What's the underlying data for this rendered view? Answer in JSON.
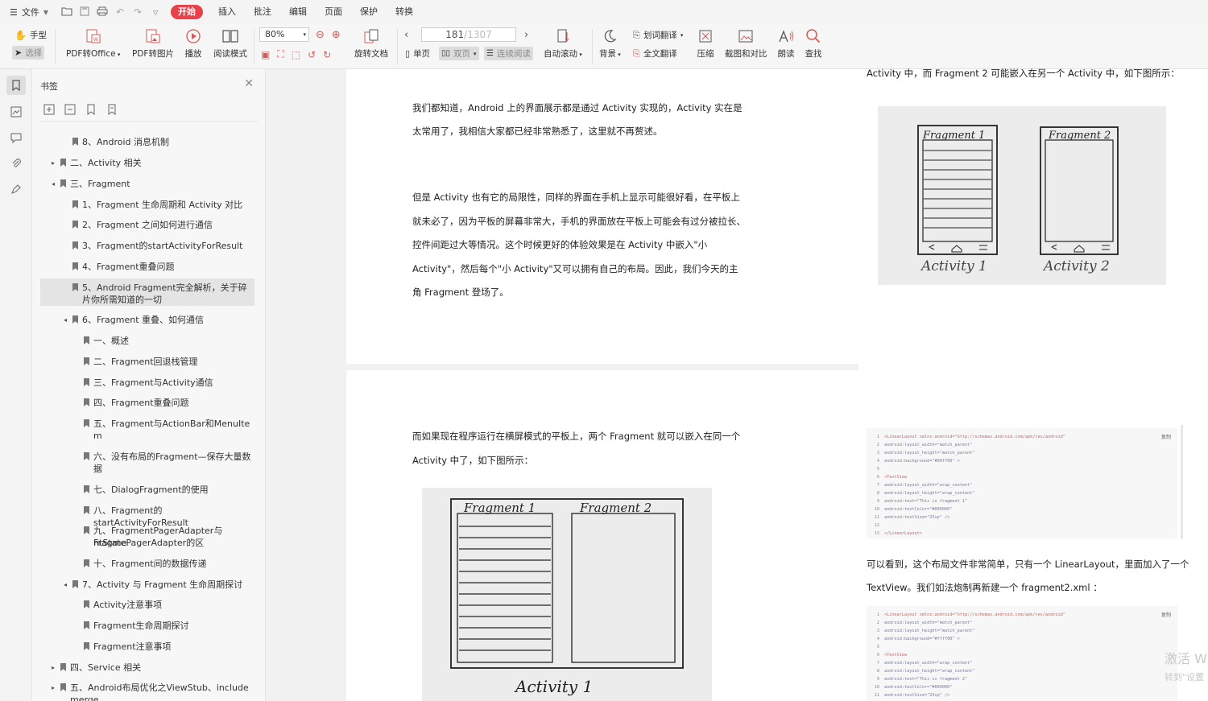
{
  "menubar": {
    "file": "文件",
    "tabs": [
      "开始",
      "插入",
      "批注",
      "编辑",
      "页面",
      "保护",
      "转换"
    ],
    "active_tab": "开始"
  },
  "toolbar": {
    "hand": "手型",
    "select": "选择",
    "pdf2office": "PDF转Office",
    "pdf2image": "PDF转图片",
    "play": "播放",
    "read_mode": "阅读模式",
    "zoom": "80%",
    "rotate": "旋转文档",
    "single": "单页",
    "double": "双页",
    "continuous": "连续阅读",
    "page_current": "181",
    "page_total": "/1307",
    "auto_scroll": "自动滚动",
    "background": "背景",
    "word_translate": "划词翻译",
    "full_translate": "全文翻译",
    "compress": "压缩",
    "screenshot_compare": "截图和对比",
    "read_aloud": "朗读",
    "find": "查找"
  },
  "bookmarks": {
    "title": "书签",
    "items": [
      {
        "text": "8、Android 消息机制",
        "level": 1,
        "arrow": ""
      },
      {
        "text": "二、Activity 相关",
        "level": 0,
        "arrow": "▸"
      },
      {
        "text": "三、Fragment",
        "level": 0,
        "arrow": "◂"
      },
      {
        "text": "1、Fragment 生命周期和 Activity 对比",
        "level": 1,
        "arrow": ""
      },
      {
        "text": "2、Fragment 之间如何进行通信",
        "level": 1,
        "arrow": ""
      },
      {
        "text": "3、Fragment的startActivityForResult",
        "level": 1,
        "arrow": ""
      },
      {
        "text": "4、Fragment重叠问题",
        "level": 1,
        "arrow": ""
      },
      {
        "text": "5、Android Fragment完全解析，关于碎",
        "text2": "片你所需知道的一切",
        "level": 1,
        "arrow": "",
        "selected": true
      },
      {
        "text": "6、Fragment 重叠、如何通信",
        "level": 1,
        "arrow": "◂"
      },
      {
        "text": "一、概述",
        "level": 2,
        "arrow": ""
      },
      {
        "text": "二、Fragment回退栈管理",
        "level": 2,
        "arrow": ""
      },
      {
        "text": "三、Fragment与Activity通信",
        "level": 2,
        "arrow": ""
      },
      {
        "text": "四、Fragment重叠问题",
        "level": 2,
        "arrow": ""
      },
      {
        "text": "五、Fragment与ActionBar和MenuIte",
        "text2": "m",
        "level": 2,
        "arrow": ""
      },
      {
        "text": "六、没有布局的Fragment—保存大量数",
        "text2": "据",
        "level": 2,
        "arrow": ""
      },
      {
        "text": "七、DialogFragment的使用",
        "level": 2,
        "arrow": ""
      },
      {
        "text": "八、Fragment的startActivityForResult",
        "level": 2,
        "arrow": ""
      },
      {
        "text": "九、FragmentPagerAdapter与Fragme",
        "text2": "ntStatePagerAdapter的区",
        "level": 2,
        "arrow": ""
      },
      {
        "text": "十、Fragment间的数据传递",
        "level": 2,
        "arrow": ""
      },
      {
        "text": "7、Activity 与 Fragment 生命周期探讨",
        "level": 1,
        "arrow": "◂"
      },
      {
        "text": "Activity注意事项",
        "level": 2,
        "arrow": ""
      },
      {
        "text": "Fragment生命周期探讨",
        "level": 2,
        "arrow": ""
      },
      {
        "text": "Fragment注意事项",
        "level": 2,
        "arrow": ""
      },
      {
        "text": "四、Service 相关",
        "level": 0,
        "arrow": "▸"
      },
      {
        "text": "五、Android布局优化之ViewStub、include",
        "text2": "merge",
        "level": 0,
        "arrow": "▸"
      }
    ]
  },
  "doc": {
    "left_page_1": [
      "我们都知道，Android 上的界面展示都是通过 Activity 实现的，Activity 实在是",
      "太常用了，我相信大家都已经非常熟悉了，这里就不再赘述。",
      "但是 Activity 也有它的局限性，同样的界面在手机上显示可能很好看，在平板上",
      "就未必了，因为平板的屏幕非常大，手机的界面放在平板上可能会有过分被拉长、",
      "控件间距过大等情况。这个时候更好的体验效果是在 Activity 中嵌入\"小",
      "Activity\"，然后每个\"小 Activity\"又可以拥有自己的布局。因此，我们今天的主",
      "角 Fragment 登场了。"
    ],
    "left_page_2": [
      "而如果现在程序运行在横屏模式的平板上，两个 Fragment 就可以嵌入在同一个",
      "Activity 中了，如下图所示："
    ],
    "right_top_line": "Activity 中，而 Fragment 2 可能嵌入在另一个 Activity 中，如下图所示：",
    "right_mid": [
      "可以看到，这个布局文件非常简单，只有一个 LinearLayout，里面加入了一个",
      "TextView。我们如法炮制再新建一个 fragment2.xml ："
    ],
    "sketch_labels": {
      "fragment1": "Fragment 1",
      "fragment2": "Fragment 2",
      "activity1": "Activity 1",
      "activity2": "Activity 2",
      "activity": "Activity 1"
    },
    "code1": {
      "copy": "复制",
      "lines": [
        "<LinearLayout xmlns:android=\"http://schemas.android.com/apk/res/android\"",
        "    android:layout_width=\"match_parent\"",
        "    android:layout_height=\"match_parent\"",
        "    android:background=\"#00ff00\" >",
        "",
        "    <TextView",
        "        android:layout_width=\"wrap_content\"",
        "        android:layout_height=\"wrap_content\"",
        "        android:text=\"This is fragment 1\"",
        "        android:textColor=\"#000000\"",
        "        android:textSize=\"25sp\" />",
        "",
        "</LinearLayout>"
      ]
    },
    "code2": {
      "copy": "复制",
      "lines": [
        "<LinearLayout xmlns:android=\"http://schemas.android.com/apk/res/android\"",
        "    android:layout_width=\"match_parent\"",
        "    android:layout_height=\"match_parent\"",
        "    android:background=\"#ffff00\" >",
        "",
        "    <TextView",
        "        android:layout_width=\"wrap_content\"",
        "        android:layout_height=\"wrap_content\"",
        "        android:text=\"This is fragment 2\"",
        "        android:textColor=\"#000000\"",
        "        android:textSize=\"25sp\" />"
      ]
    }
  },
  "watermark": {
    "line1": "激活 W",
    "line2": "转到\"设置"
  }
}
